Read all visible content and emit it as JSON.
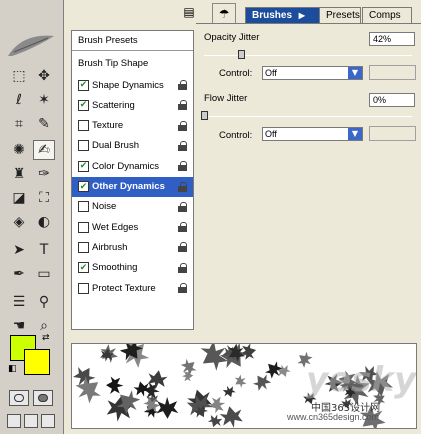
{
  "tabs": {
    "active": "Brushes",
    "others": [
      "Presets",
      "Comps"
    ]
  },
  "brush_list": {
    "presets_label": "Brush Presets",
    "section_label": "Brush Tip Shape",
    "items": [
      {
        "label": "Shape Dynamics",
        "checked": true,
        "selected": false
      },
      {
        "label": "Scattering",
        "checked": true,
        "selected": false
      },
      {
        "label": "Texture",
        "checked": false,
        "selected": false
      },
      {
        "label": "Dual Brush",
        "checked": false,
        "selected": false
      },
      {
        "label": "Color Dynamics",
        "checked": true,
        "selected": false
      },
      {
        "label": "Other Dynamics",
        "checked": true,
        "selected": true
      },
      {
        "label": "Noise",
        "checked": false,
        "selected": false
      },
      {
        "label": "Wet Edges",
        "checked": false,
        "selected": false
      },
      {
        "label": "Airbrush",
        "checked": false,
        "selected": false
      },
      {
        "label": "Smoothing",
        "checked": true,
        "selected": false
      },
      {
        "label": "Protect Texture",
        "checked": false,
        "selected": false
      }
    ]
  },
  "settings": {
    "opacity_jitter": {
      "label": "Opacity Jitter",
      "value": "42%",
      "level": 0.42
    },
    "opacity_control": {
      "label": "Control:",
      "value": "Off"
    },
    "flow_jitter": {
      "label": "Flow Jitter",
      "value": "0%",
      "level": 0
    },
    "flow_control": {
      "label": "Control:",
      "value": "Off"
    }
  },
  "colors": {
    "foreground": "#ccff00",
    "background": "#ffff00",
    "accent": "#1c4c9c",
    "selection": "#2f5ec4"
  },
  "watermark": {
    "logo_text": "yesky",
    "cn_text": "中国365设计网",
    "url": "www.cn365design.com"
  }
}
